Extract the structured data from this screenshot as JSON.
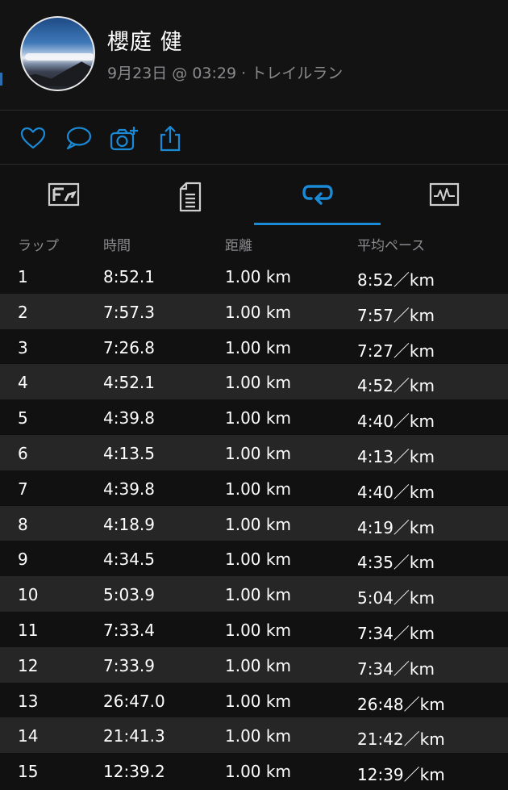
{
  "header": {
    "name": "櫻庭 健",
    "meta": "9月23日 @ 03:29 · トレイルラン"
  },
  "actions": [
    "heart-icon",
    "comment-icon",
    "camera-add-icon",
    "share-icon"
  ],
  "tabs": [
    {
      "icon": "overview-icon",
      "active": false
    },
    {
      "icon": "details-icon",
      "active": false
    },
    {
      "icon": "laps-icon",
      "active": true
    },
    {
      "icon": "chart-icon",
      "active": false
    }
  ],
  "colors": {
    "accent": "#1a8ad6",
    "muted": "#8a8a8e",
    "row_alt": "#262626",
    "background": "#111111"
  },
  "table": {
    "headers": [
      "ラップ",
      "時間",
      "距離",
      "平均ペース"
    ],
    "rows": [
      [
        "1",
        "8:52.1",
        "1.00 km",
        "8:52／km"
      ],
      [
        "2",
        "7:57.3",
        "1.00 km",
        "7:57／km"
      ],
      [
        "3",
        "7:26.8",
        "1.00 km",
        "7:27／km"
      ],
      [
        "4",
        "4:52.1",
        "1.00 km",
        "4:52／km"
      ],
      [
        "5",
        "4:39.8",
        "1.00 km",
        "4:40／km"
      ],
      [
        "6",
        "4:13.5",
        "1.00 km",
        "4:13／km"
      ],
      [
        "7",
        "4:39.8",
        "1.00 km",
        "4:40／km"
      ],
      [
        "8",
        "4:18.9",
        "1.00 km",
        "4:19／km"
      ],
      [
        "9",
        "4:34.5",
        "1.00 km",
        "4:35／km"
      ],
      [
        "10",
        "5:03.9",
        "1.00 km",
        "5:04／km"
      ],
      [
        "11",
        "7:33.4",
        "1.00 km",
        "7:34／km"
      ],
      [
        "12",
        "7:33.9",
        "1.00 km",
        "7:34／km"
      ],
      [
        "13",
        "26:47.0",
        "1.00 km",
        "26:48／km"
      ],
      [
        "14",
        "21:41.3",
        "1.00 km",
        "21:42／km"
      ],
      [
        "15",
        "12:39.2",
        "1.00 km",
        "12:39／km"
      ]
    ]
  }
}
